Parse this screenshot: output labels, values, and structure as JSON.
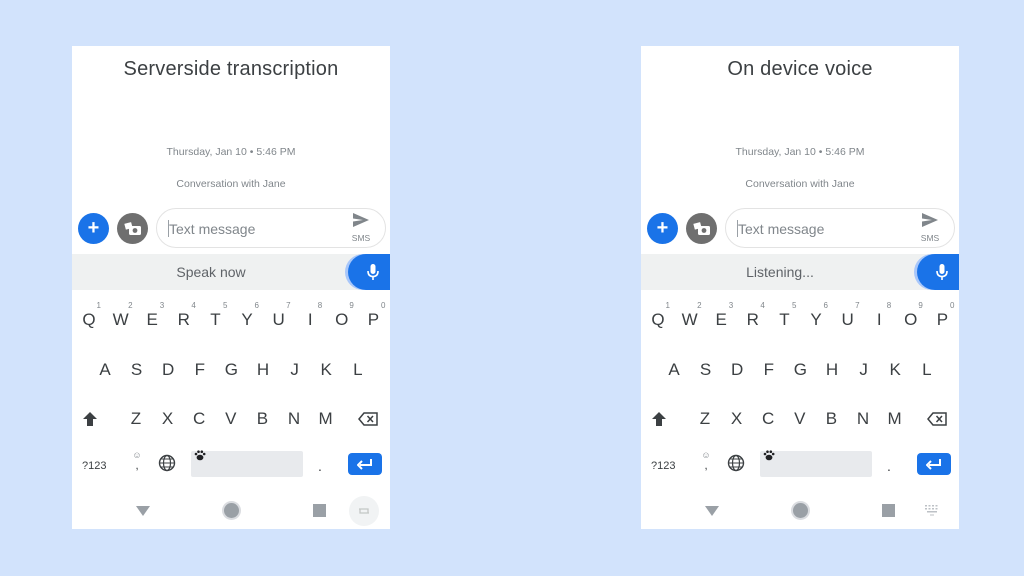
{
  "colors": {
    "background": "#d2e3fc",
    "accent": "#1a73e8",
    "voicebar": "#eff1f1"
  },
  "panels": [
    {
      "id": "left",
      "title": "Serverside transcription",
      "timestamp": "Thursday, Jan 10 • 5:46 PM",
      "conversation": "Conversation with Jane",
      "compose": {
        "placeholder": "Text message",
        "send_label": "SMS",
        "add_icon": "plus-icon",
        "camera_icon": "camera-gallery-icon"
      },
      "voice_status": "Speak now",
      "nav_extra": "rotate-icon"
    },
    {
      "id": "right",
      "title": "On device voice",
      "timestamp": "Thursday, Jan 10 • 5:46 PM",
      "conversation": "Conversation with Jane",
      "compose": {
        "placeholder": "Text message",
        "send_label": "SMS",
        "add_icon": "plus-icon",
        "camera_icon": "camera-gallery-icon"
      },
      "voice_status": "Listening...",
      "nav_extra": "keyboard-icon"
    }
  ],
  "keyboard": {
    "row1": [
      {
        "k": "Q",
        "h": "1"
      },
      {
        "k": "W",
        "h": "2"
      },
      {
        "k": "E",
        "h": "3"
      },
      {
        "k": "R",
        "h": "4"
      },
      {
        "k": "T",
        "h": "5"
      },
      {
        "k": "Y",
        "h": "6"
      },
      {
        "k": "U",
        "h": "7"
      },
      {
        "k": "I",
        "h": "8"
      },
      {
        "k": "O",
        "h": "9"
      },
      {
        "k": "P",
        "h": "0"
      }
    ],
    "row2": [
      "A",
      "S",
      "D",
      "F",
      "G",
      "H",
      "J",
      "K",
      "L"
    ],
    "row3": [
      "Z",
      "X",
      "C",
      "V",
      "B",
      "N",
      "M"
    ],
    "symbols_label": "?123",
    "comma_label": ",",
    "period_label": "."
  }
}
